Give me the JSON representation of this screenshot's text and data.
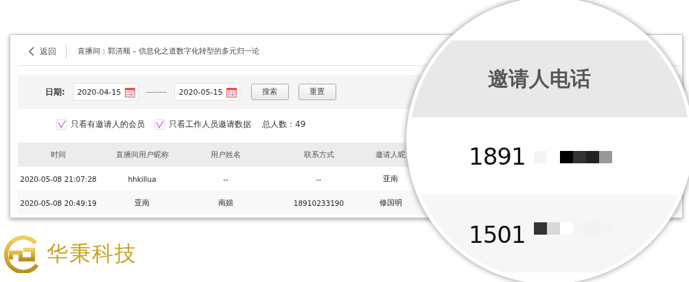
{
  "header": {
    "back_label": "返回",
    "title": "直播间：郭清顺 – 信息化之道数字化转型的多元归一论"
  },
  "filters": {
    "date_label": "日期:",
    "start_date": "2020-04-15",
    "end_date": "2020-05-15",
    "buttons": [
      "搜索",
      "重置"
    ]
  },
  "options": [
    {
      "label": "只看有邀请人的会员",
      "checked": true
    },
    {
      "label": "只看工作人员邀请数据",
      "checked": true
    }
  ],
  "total": "总人数：49",
  "table": {
    "columns": [
      "时间",
      "直播间用户昵称",
      "用户姓名",
      "联系方式",
      "邀请人昵"
    ],
    "rows": [
      [
        "2020-05-08 21:07:28",
        "hhkillua",
        "--",
        "--",
        "亚南"
      ],
      [
        "2020-05-08 20:49:19",
        "亚南",
        "南姐",
        "18910233190",
        "修国明"
      ]
    ]
  },
  "magnifier": {
    "column": "邀请人电话",
    "rows": [
      "1891",
      "1501"
    ]
  },
  "logo": {
    "text": "华秉科技"
  }
}
